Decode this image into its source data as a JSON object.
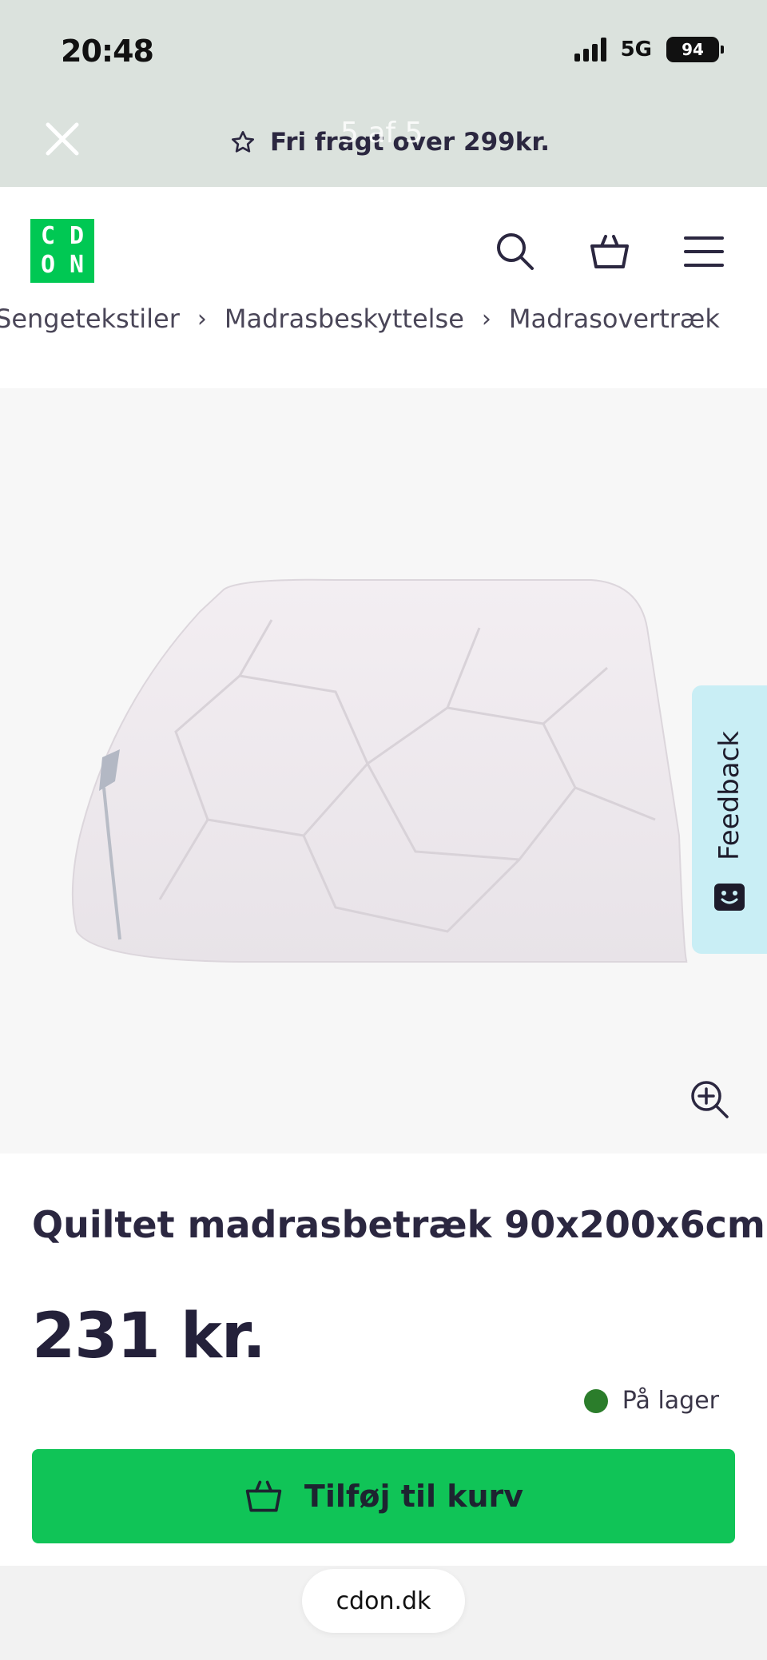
{
  "status_bar": {
    "time": "20:48",
    "network": "5G",
    "battery": "94"
  },
  "overlay": {
    "viewer_count": "5 af 5"
  },
  "promo": {
    "text": "Fri fragt over 299kr."
  },
  "header": {
    "logo_letters": [
      "C",
      "D",
      "O",
      "N"
    ],
    "brand_color": "#00c853"
  },
  "breadcrumb": [
    "Sengetekstiler",
    "Madrasbeskyttelse",
    "Madrasovertræk"
  ],
  "feedback": {
    "label": "Feedback"
  },
  "product": {
    "title": "Quiltet madrasbetræk 90x200x6cm",
    "price": "231 kr.",
    "stock": "På lager",
    "stock_color": "#2b7d2b"
  },
  "cart_button": {
    "label": "Tilføj til kurv",
    "color": "#10c457"
  },
  "browser": {
    "url": "cdon.dk"
  }
}
